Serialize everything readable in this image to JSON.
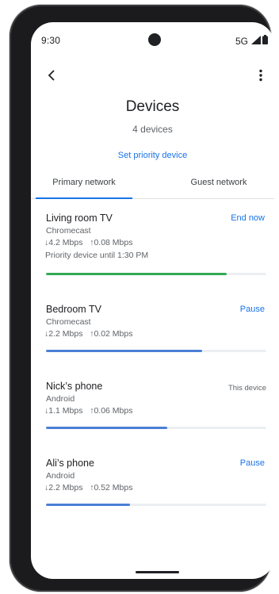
{
  "status_bar": {
    "time": "9:30",
    "network": "5G",
    "signal_icon": "signal-icon",
    "battery_icon": "battery-icon"
  },
  "app_bar": {
    "back_icon": "back-arrow-icon",
    "more_icon": "more-vert-icon"
  },
  "header": {
    "title": "Devices",
    "count": "4 devices",
    "priority_link": "Set priority device"
  },
  "tabs": [
    {
      "label": "Primary network",
      "selected": true
    },
    {
      "label": "Guest network",
      "selected": false
    }
  ],
  "devices": [
    {
      "name": "Living room TV",
      "type": "Chromecast",
      "speed": "↓4.2 Mbps   ↑0.08 Mbps",
      "priority": "Priority device until 1:30 PM",
      "action": "End now",
      "usage": 0.82,
      "bar_color": "#34a853"
    },
    {
      "name": "Bedroom TV",
      "type": "Chromecast",
      "speed": "↓2.2 Mbps   ↑0.02 Mbps",
      "action": "Pause",
      "usage": 0.71,
      "bar_color": "#4a7fd6"
    },
    {
      "name": "Nick’s phone",
      "type": "Android",
      "speed": "↓1.1 Mbps   ↑0.06 Mbps",
      "action": "This device",
      "usage": 0.55,
      "bar_color": "#4a7fd6"
    },
    {
      "name": "Ali’s phone",
      "type": "Android",
      "speed": "↓2.2 Mbps   ↑0.52 Mbps",
      "action": "Pause",
      "usage": 0.38,
      "bar_color": "#4a7fd6"
    }
  ],
  "colors": {
    "accent": "#1a73e8",
    "priority_bar": "#34a853",
    "usage_bar": "#4a7fd6"
  }
}
